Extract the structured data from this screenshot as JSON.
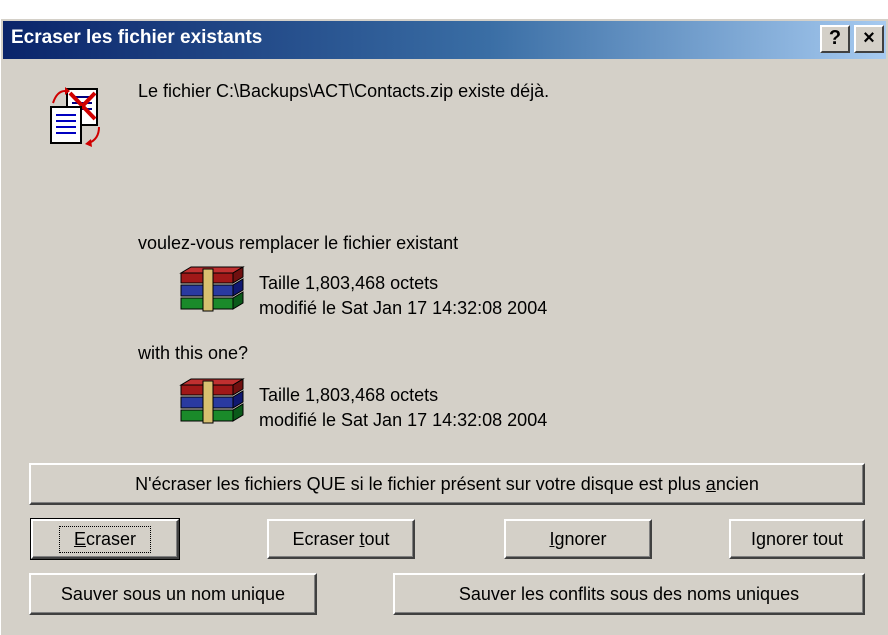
{
  "window": {
    "title": "Ecraser les fichier existants",
    "help_button": "?",
    "close_button": "×"
  },
  "message": {
    "exists_line": "Le fichier C:\\Backups\\ACT\\Contacts.zip existe déjà.",
    "replace_question": "voulez-vous remplacer le fichier existant",
    "with_this_one": "with this one?"
  },
  "existing_file": {
    "size_text": "Taille 1,803,468 octets",
    "modified_text": "modifié le Sat Jan 17 14:32:08 2004"
  },
  "new_file": {
    "size_text": "Taille 1,803,468 octets",
    "modified_text": "modifié le Sat Jan 17 14:32:08 2004"
  },
  "buttons": {
    "older_only": {
      "pre": "N'écraser les fichiers QUE si le fichier présent sur votre disque est plus ",
      "u": "a",
      "post": "ncien"
    },
    "ecraser": {
      "pre": "",
      "u": "E",
      "post": "craser"
    },
    "ecraser_tout": {
      "pre": "Ecraser ",
      "u": "t",
      "post": "out"
    },
    "ignorer": {
      "pre": "",
      "u": "I",
      "post": "gnorer"
    },
    "ignorer_tout": "Ignorer tout",
    "sauver_unique": "Sauver sous un nom unique",
    "sauver_conflits": "Sauver les conflits sous des noms uniques"
  },
  "icons": {
    "dialog_icon": "file-replace-icon",
    "archive_icon": "winrar-archive-icon"
  }
}
